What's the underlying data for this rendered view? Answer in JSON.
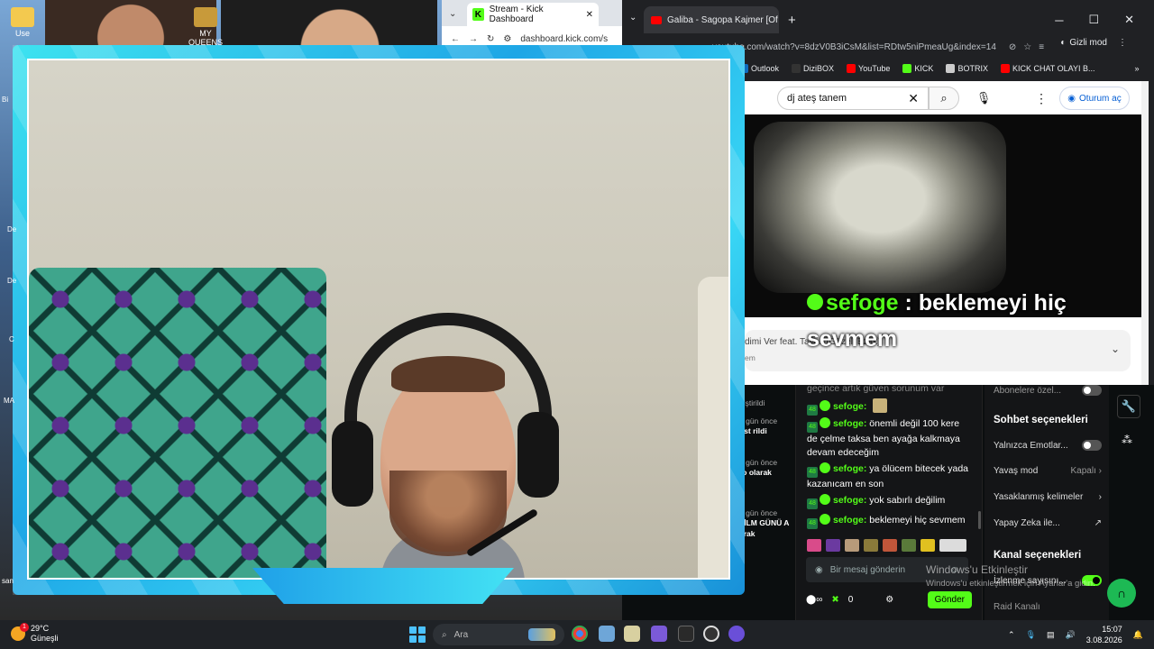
{
  "desktop": {
    "icons": [
      {
        "label": "Use"
      },
      {
        "label": "MY QUEENS"
      }
    ],
    "side_labels": [
      "Bi",
      "De",
      "De",
      "C",
      "MA",
      "san"
    ]
  },
  "kick_window": {
    "tab_title": "Stream - Kick Dashboard",
    "url": "dashboard.kick.com/s"
  },
  "youtube_window": {
    "tab_title": "Galiba - Sagopa Kajmer [Of",
    "url": "youtube.com/watch?v=8dzV0B3iCsM&list=RDtw5niPmeaUg&index=14",
    "incognito_label": "Gizli mod",
    "bookmarks": [
      {
        "label": "Outlook",
        "color": "#0f6cbd"
      },
      {
        "label": "DiziBOX",
        "color": "#222222"
      },
      {
        "label": "YouTube",
        "color": "#ff0000"
      },
      {
        "label": "KICK",
        "color": "#53fc18"
      },
      {
        "label": "BOTRIX",
        "color": "#cccccc"
      },
      {
        "label": "KICK CHAT OLAYI B...",
        "color": "#ff0000"
      }
    ],
    "search_value": "dj ateş tanem",
    "signin_label": "Oturum aç",
    "video_title_partial": "dimi Ver feat. Tala... (Güzeli Bzak)",
    "video_sub_partial": "em"
  },
  "overlay_chat": {
    "username": "sefoge",
    "separator": " : ",
    "message": "beklemeyi hiç sevmem"
  },
  "left_feed": [
    {
      "time": "",
      "text": "ğiştirildi"
    },
    {
      "time": "1 gün önce",
      "text": "ust rildi"
    },
    {
      "time": "1 gün önce",
      "text": "ro olarak"
    },
    {
      "time": "1 gün önce",
      "text": "FİLM GÜNÜ A arak"
    }
  ],
  "chat": {
    "partial_top": "geçince artık güven sorunum var",
    "messages": [
      {
        "user": "sefoge:",
        "text": ""
      },
      {
        "user": "sefoge:",
        "text": "önemli değil 100 kere de çelme taksa ben ayağa kalkmaya devam edeceğim"
      },
      {
        "user": "sefoge:",
        "text": "ya ölücem bitecek yada kazanıcam en son"
      },
      {
        "user": "sefoge:",
        "text": "yok sabırlı değilim"
      },
      {
        "user": "sefoge:",
        "text": "beklemeyi hiç sevmem"
      }
    ],
    "badge_text": "48",
    "input_placeholder": "Bir mesaj gönderin",
    "points": "0",
    "send_label": "Gönder"
  },
  "settings": {
    "subs_only": "Abonelere özel...",
    "chat_options_title": "Sohbet seçenekleri",
    "emotes_only": "Yalnızca Emotlar...",
    "slow_mode": "Yavaş mod",
    "slow_mode_value": "Kapalı",
    "banned_words": "Yasaklanmış kelimeler",
    "ai": "Yapay Zeka ile...",
    "channel_options_title": "Kanal seçenekleri",
    "viewer_count": "İzlenme sayısını...",
    "raid": "Raid Kanalı"
  },
  "watermark": {
    "line1": "Windows'u Etkinleştir",
    "line2": "Windows'u etkinleştirmek için Ayarlar'a gidin."
  },
  "taskbar": {
    "temperature": "29°C",
    "weather": "Güneşli",
    "weather_badge": "1",
    "search_placeholder": "Ara",
    "time": "15:07",
    "date": "3.08.2026"
  }
}
